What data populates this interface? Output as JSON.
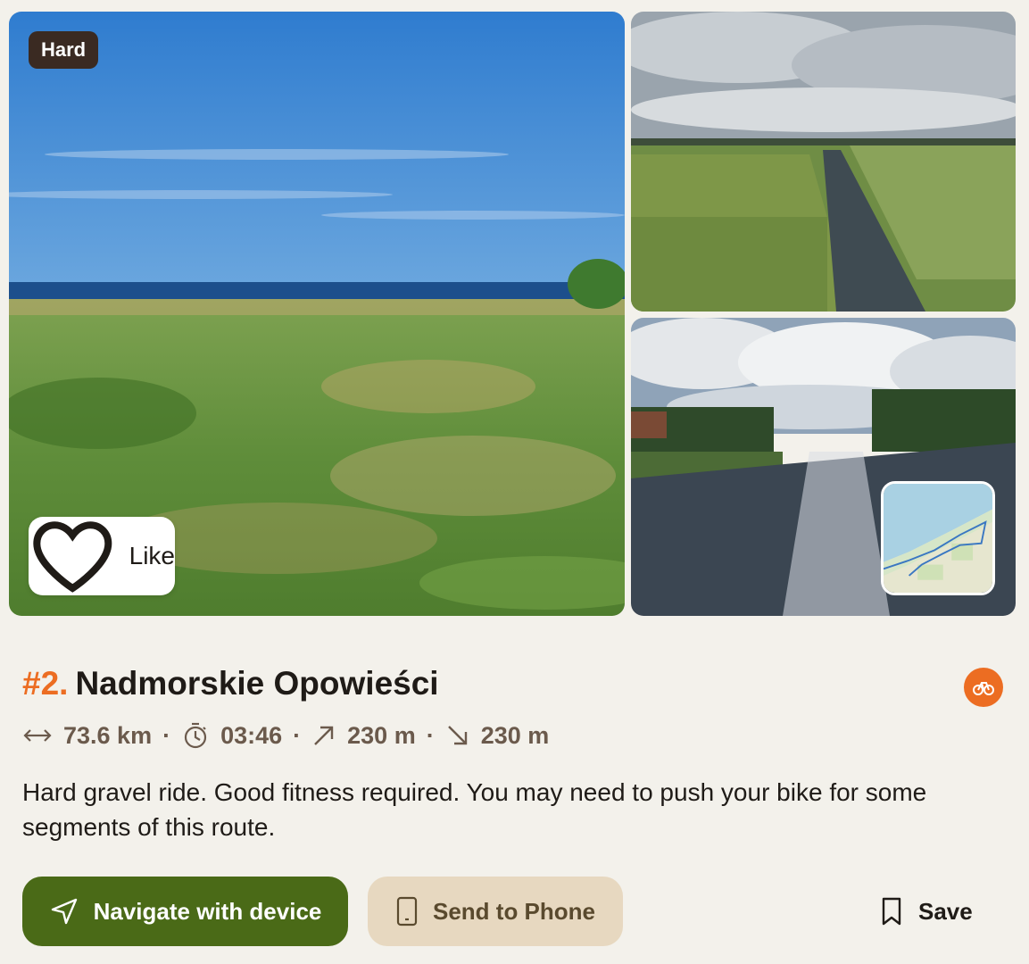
{
  "difficulty_badge": "Hard",
  "like_label": "Like",
  "route": {
    "rank": "#2.",
    "title": "Nadmorskie Opowieści"
  },
  "stats": {
    "distance": "73.6 km",
    "duration": "03:46",
    "ascent": "230 m",
    "descent": "230 m",
    "separator": "·"
  },
  "description": "Hard gravel ride. Good fitness required. You may need to push your bike for some segments of this route.",
  "actions": {
    "navigate_label": "Navigate with device",
    "send_label": "Send to Phone",
    "save_label": "Save"
  },
  "colors": {
    "accent": "#ec6d22",
    "primary_button": "#4a6a17",
    "secondary_button": "#e7d8c0",
    "background": "#f3f1eb"
  },
  "icons": {
    "like": "heart-icon",
    "distance": "horizontal-arrows-icon",
    "duration": "stopwatch-icon",
    "ascent": "arrow-up-right-icon",
    "descent": "arrow-down-right-icon",
    "navigate": "navigation-arrow-icon",
    "send": "phone-icon",
    "save": "bookmark-icon",
    "sport": "bicycle-icon"
  }
}
